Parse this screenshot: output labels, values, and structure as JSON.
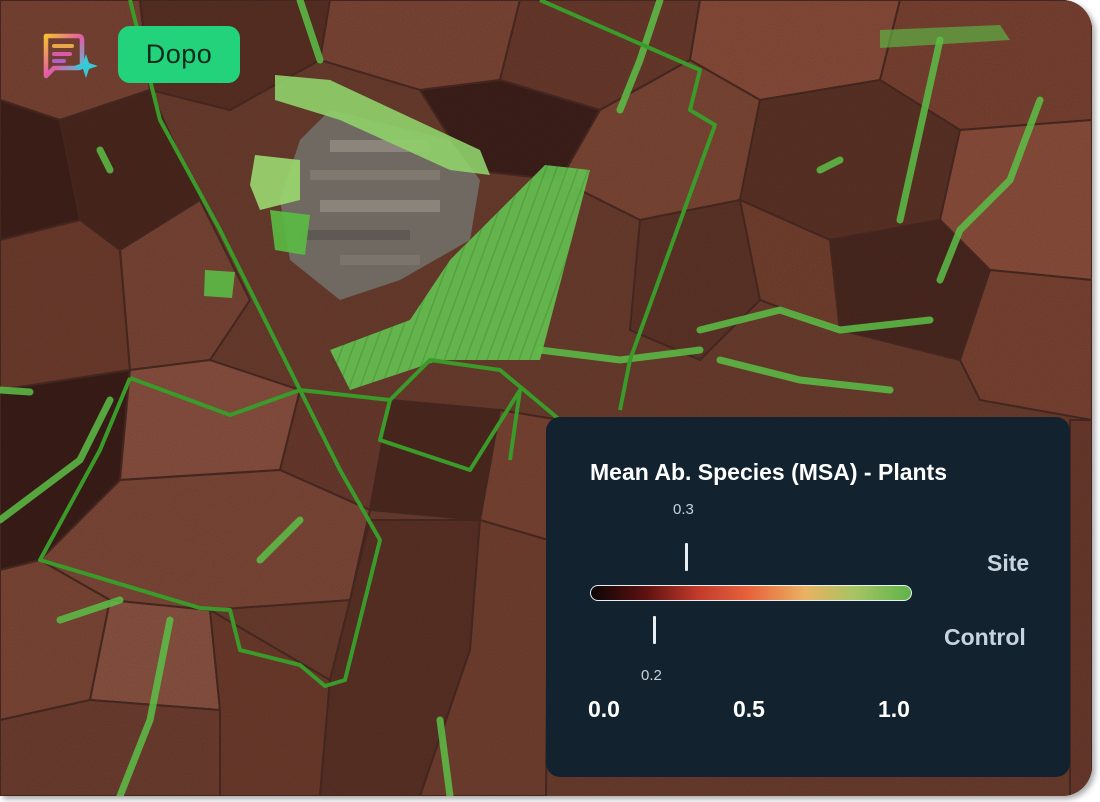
{
  "app": {
    "mode_label": "Dopo",
    "logo_icon": "sparkle-notes-icon"
  },
  "legend": {
    "title": "Mean Ab. Species (MSA) - Plants",
    "site_label": "Site",
    "control_label": "Control",
    "site_value": 0.3,
    "control_value": 0.2,
    "site_value_text": "0.3",
    "control_value_text": "0.2",
    "scale_min_label": "0.0",
    "scale_mid_label": "0.5",
    "scale_max_label": "1.0",
    "colors": [
      "#0c0505",
      "#5c1111",
      "#c0392b",
      "#e8653d",
      "#e9b262",
      "#a4c463",
      "#5fb34a"
    ]
  },
  "map": {
    "boundary_color": "#3a9a2a",
    "vegetation_color": "#5fbf4a"
  }
}
